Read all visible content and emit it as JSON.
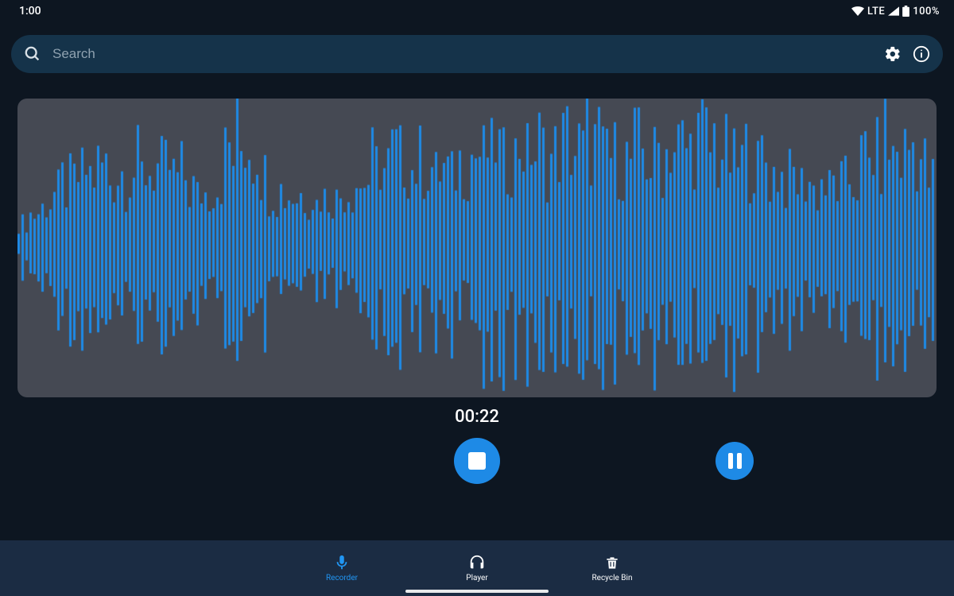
{
  "status": {
    "time": "1:00",
    "network": "LTE",
    "battery": "100%"
  },
  "search": {
    "placeholder": "Search"
  },
  "timer": {
    "elapsed": "00:22"
  },
  "nav": {
    "items": [
      {
        "key": "recorder",
        "label": "Recorder",
        "active": true
      },
      {
        "key": "player",
        "label": "Player",
        "active": false
      },
      {
        "key": "recycle",
        "label": "Recycle Bin",
        "active": false
      }
    ]
  },
  "colors": {
    "accent": "#1e8ae6",
    "waveform": "#1e8ae6"
  }
}
